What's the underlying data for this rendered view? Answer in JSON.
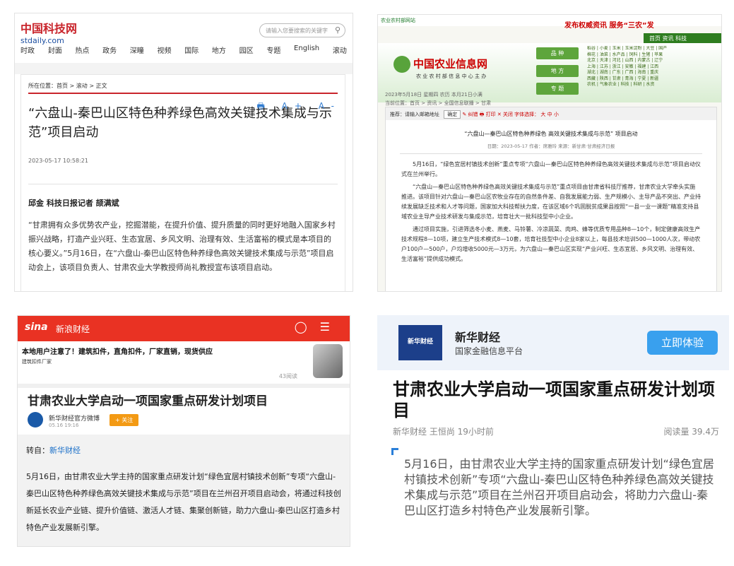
{
  "panel_a": {
    "logo": "中国科技网",
    "logo_sub": "stdaily.com",
    "search_placeholder": "请输入您要搜索的关键字",
    "nav": [
      "时政",
      "封面",
      "热点",
      "政务",
      "深瞳",
      "视频",
      "国际",
      "地方",
      "园区",
      "专题",
      "English",
      "滚动"
    ],
    "breadcrumb": "所在位置：首页 > 滚动 > 正文",
    "title": "“六盘山-秦巴山区特色种养绿色高效关键技术集成与示范”项目启动",
    "date": "2023-05-17 10:58:21",
    "tools": "🖶 A+ A-",
    "authors": "邱金  科技日报记者  颉满斌",
    "body": "“甘肃拥有众多优势农产业，挖掘潜能，在提升价值、提升质量的同时更好地融入国家乡村振兴战略，打造产业兴旺、生态宜居、乡风文明、治理有效、生活富裕的模式是本项目的核心要义。”5月16日，在“六盘山-秦巴山区特色种养绿色高效关键技术集成与示范”项目启动会上，该项目负责人、甘肃农业大学教授师尚礼教授宣布该项目启动。"
  },
  "panel_b": {
    "top_label": "农业农村部网站",
    "slogan": "发布权威资讯    服务“三农”发",
    "menu": "首页  资讯  科技",
    "logo": "中国农业信息网",
    "logo_sub": "农 业 农 村 部 信 息 中 心 主 办",
    "cats": [
      "品 种",
      "地 方",
      "专 题"
    ],
    "grid": "稻谷 | 小麦 | 玉米 | 玉米淀粉 | 大豆 | 国产\n棉花 | 油菜 | 水产品 | 饲料 | 生猪 | 苹果\n北京 | 天津 | 河北 | 山西 | 内蒙古 | 辽宁\n上海 | 江苏 | 浙江 | 安徽 | 福建 | 江西\n湖北 | 湖南 | 广东 | 广西 | 海南 | 重庆\n西藏 | 陕西 | 甘肃 | 青海 | 宁夏 | 新疆\n农机 | 气象农业 | 科技 | 科研 | 水资",
    "datebar": "2023年5月18日 星期四 农历 本月21日小满",
    "location": "当前位置：首页 > 资讯 > 全国信息联播 > 甘肃",
    "toolbar": "推荐：请输入邮箱地址",
    "toolbar_btn": "确定",
    "toolbar_items": "✎ 纠错    🖶 打印    ✕ 关闭      字体选择： 大  中  小",
    "title": "“六盘山—秦巴山区特色种养绿色 高效关键技术集成与示范” 项目启动",
    "meta": "日期：2023-05-17  作者：席雅玲  来源：新甘肃·甘肃经济日报",
    "p1": "5月16日，“绿色宜居村镇技术创新”重点专项“六盘山—秦巴山区特色种养绿色高效关键技术集成与示范”项目启动仪式在兰州举行。",
    "p2": "“六盘山—秦巴山区特色种养绿色高效关键技术集成与示范”重点项目由甘肃省科技厅推荐，甘肃农业大学牵头实施推进。该项目针对六盘山—秦巴山区农牧业存在的自然条件差、自我发展能力弱、生产规模小、主导产品不突出、产业持续发展缺乏技术和人才等问题，国家加大科技帮扶力度，在该区域6个巩固脱贫成果县按照“一县一业一课题”精准支持县域农业主导产业技术研发与集成示范，培育壮大一批科技型中小企业。",
    "p3": "通过项目实施，引进筛选冬小麦、燕麦、马铃薯、冷凉蔬菜、肉鸡、蜂等优质专用品种8—10个，制定健康高效生产技术规程8—10项，建立生产技术模式8—10套，培育社技型中小企业8家以上，每县技术培训500—1000人次，带动农户100户—500户，户均增收5000元—3万元，为六盘山—秦巴山区实现“产业兴旺、生态宜居、乡风文明、治理有效、生活富裕”提供成功模式。"
  },
  "panel_c": {
    "brand": "sina",
    "section": "新浪财经",
    "ad_title": "本地用户注意了！建筑扣件，直角扣件，厂家直销，现货供应",
    "ad_sub": "建筑扣件厂家",
    "reads": "43阅读",
    "title": "甘肃农业大学启动一项国家重点研发计划项目",
    "author": "新华财经官方微博",
    "author_time": "05.16  19:16",
    "follow": "+ 关注",
    "source_prefix": "转自：",
    "source_link": "新华财经",
    "paragraph": "5月16日，由甘肃农业大学主持的国家重点研发计划“绿色宜居村镇技术创新”专项“六盘山-秦巴山区特色种养绿色高效关键技术集成与示范”项目在兰州召开项目启动会，将通过科技创新延长农业产业链、提升价值链、激活人才链、集聚创新链，助力六盘山-秦巴山区打造乡村特色产业发展新引擎。"
  },
  "panel_d": {
    "logo": "新华财经",
    "name": "新华财经",
    "subtitle": "国家金融信息平台",
    "cta": "立即体验",
    "title": "甘肃农业大学启动一项国家重点研发计划项目",
    "meta": "新华财经  王恒尚  19小时前",
    "reads": "阅读量 39.4万",
    "lead": "5月16日，由甘肃农业大学主持的国家重点研发计划“绿色宜居村镇技术创新”专项“六盘山-秦巴山区特色种养绿色高效关键技术集成与示范”项目在兰州召开项目启动会，将助力六盘山-秦巴山区打造乡村特色产业发展新引擎。"
  }
}
